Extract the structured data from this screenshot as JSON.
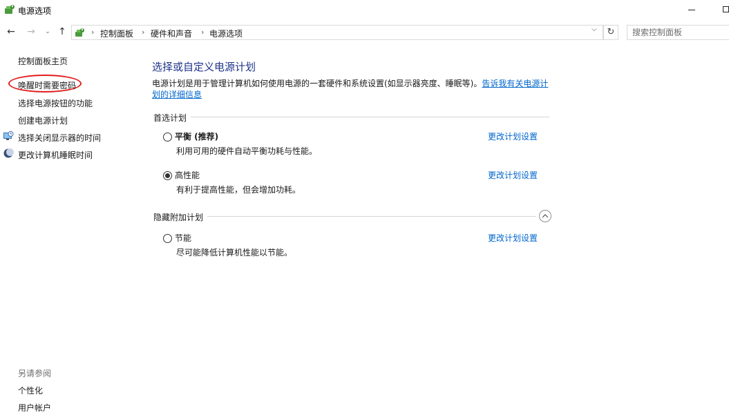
{
  "window": {
    "title": "电源选项"
  },
  "address_bar": {
    "breadcrumbs": [
      "控制面板",
      "硬件和声音",
      "电源选项"
    ],
    "search_placeholder": "搜索控制面板",
    "icons": {
      "back": "back-arrow-icon",
      "forward": "forward-arrow-icon",
      "recent": "chevron-down-icon",
      "up": "up-arrow-icon",
      "refresh": "refresh-icon"
    }
  },
  "sidebar": {
    "links": [
      {
        "label": "控制面板主页",
        "icon": null
      },
      {
        "label": "唤醒时需要密码",
        "icon": null,
        "highlighted": true
      },
      {
        "label": "选择电源按钮的功能",
        "icon": null
      },
      {
        "label": "创建电源计划",
        "icon": null
      },
      {
        "label": "选择关闭显示器的时间",
        "icon": "monitor-clock-icon"
      },
      {
        "label": "更改计算机睡眠时间",
        "icon": "moon-icon"
      }
    ],
    "see_also": {
      "heading": "另请参阅",
      "links": [
        "个性化",
        "用户帐户"
      ]
    }
  },
  "main": {
    "title": "选择或自定义电源计划",
    "description": "电源计划是用于管理计算机如何使用电源的一套硬件和系统设置(如显示器亮度、睡眠等)。",
    "description_link": "告诉我有关电源计划的详细信息",
    "preferred": {
      "heading": "首选计划",
      "plans": [
        {
          "name": "平衡 (推荐)",
          "description": "利用可用的硬件自动平衡功耗与性能。",
          "selected": false,
          "link": "更改计划设置"
        },
        {
          "name": "高性能",
          "description": "有利于提高性能，但会增加功耗。",
          "selected": true,
          "link": "更改计划设置"
        }
      ]
    },
    "hidden": {
      "heading": "隐藏附加计划",
      "plans": [
        {
          "name": "节能",
          "description": "尽可能降低计算机性能以节能。",
          "selected": false,
          "link": "更改计划设置"
        }
      ]
    }
  },
  "colors": {
    "title_blue": "#1e3287",
    "link_blue": "#0066cc",
    "highlight_red": "#e21c1c"
  }
}
